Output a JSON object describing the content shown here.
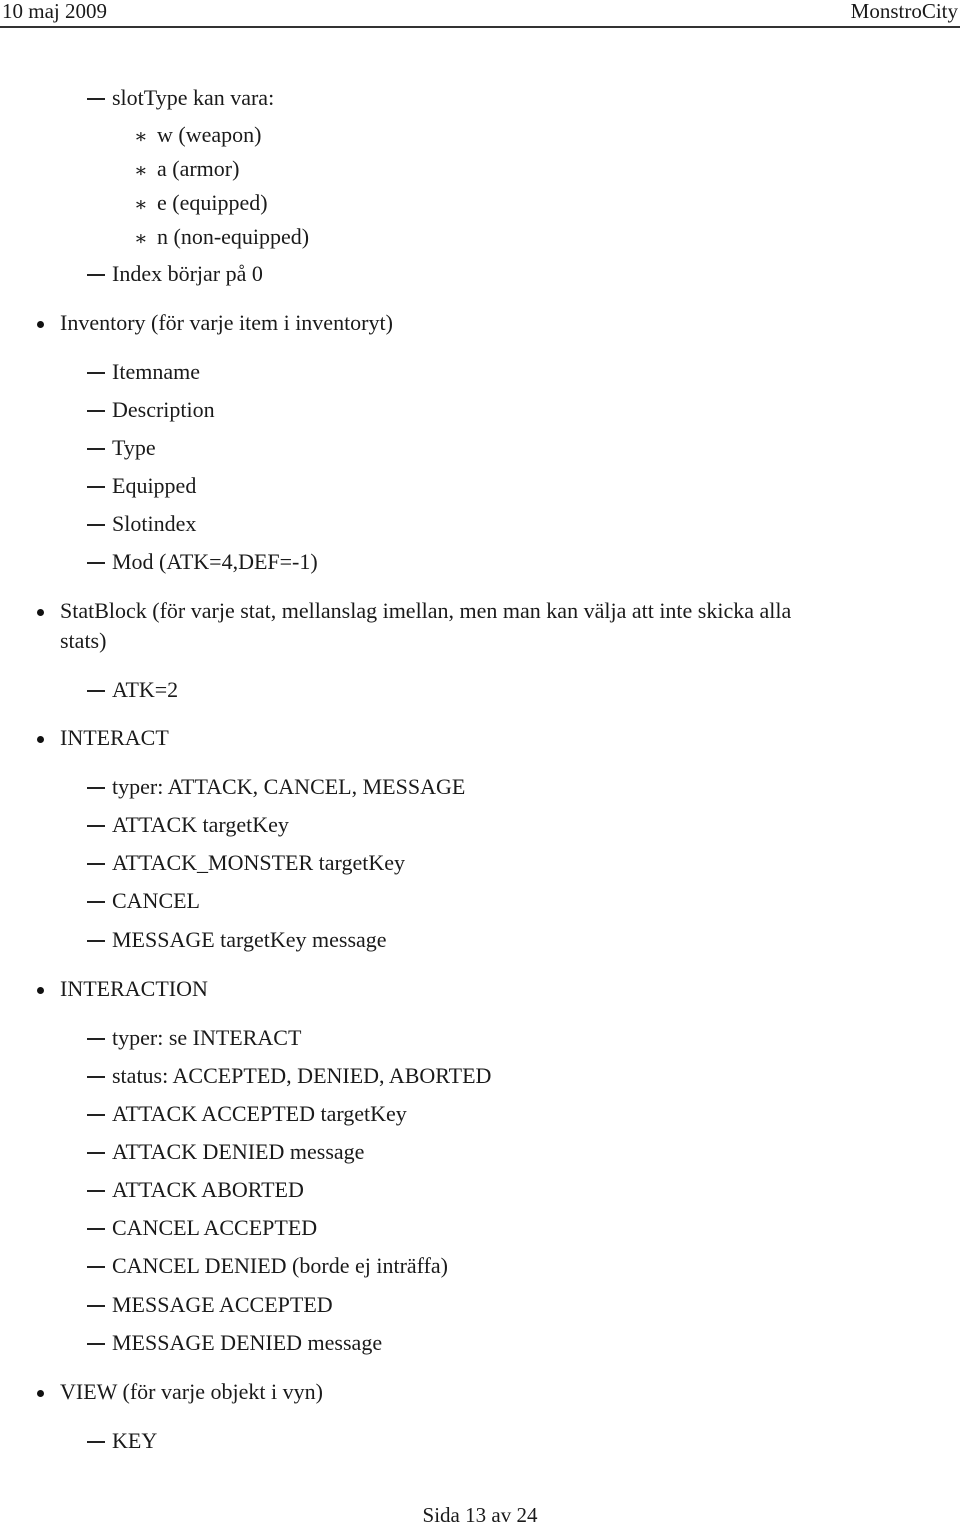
{
  "header": {
    "date": "10 maj 2009",
    "title": "MonstroCity"
  },
  "content": {
    "slottype_intro": "slotType kan vara:",
    "slottypes": [
      "w (weapon)",
      "a (armor)",
      "e (equipped)",
      "n (non-equipped)"
    ],
    "index_note": "Index börjar på 0",
    "inventory": {
      "label": "Inventory (för varje item i inventoryt)",
      "items": [
        "Itemname",
        "Description",
        "Type",
        "Equipped",
        "Slotindex",
        "Mod (ATK=4,DEF=-1)"
      ]
    },
    "statblock": {
      "label_line1": "StatBlock (för varje stat, mellanslag imellan, men man kan välja att inte skicka alla",
      "label_line2": "stats)",
      "items": [
        "ATK=2"
      ]
    },
    "interact": {
      "label": "INTERACT",
      "items": [
        "typer: ATTACK, CANCEL, MESSAGE",
        "ATTACK targetKey",
        "ATTACK_MONSTER targetKey",
        "CANCEL",
        "MESSAGE targetKey message"
      ]
    },
    "interaction": {
      "label": "INTERACTION",
      "items": [
        "typer: se INTERACT",
        "status: ACCEPTED, DENIED, ABORTED",
        "ATTACK ACCEPTED targetKey",
        "ATTACK DENIED message",
        "ATTACK ABORTED",
        "CANCEL ACCEPTED",
        "CANCEL DENIED (borde ej inträffa)",
        "MESSAGE ACCEPTED",
        "MESSAGE DENIED message"
      ]
    },
    "view": {
      "label": "VIEW (för varje objekt i vyn)",
      "items": [
        "KEY"
      ]
    }
  },
  "footer": {
    "page_label": "Sida 13 av 24"
  }
}
